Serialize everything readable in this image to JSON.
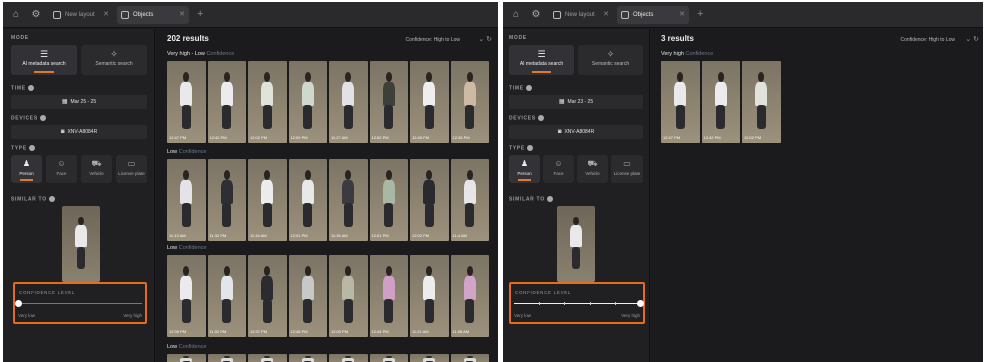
{
  "left": {
    "tabs": [
      {
        "label": "New layout",
        "active": false
      },
      {
        "label": "Objects",
        "active": true
      }
    ],
    "sidebar": {
      "mode_label": "MODE",
      "modes": [
        {
          "label": "AI metadata search",
          "icon": "layers-icon",
          "active": true
        },
        {
          "label": "Semantic search",
          "icon": "sparkle-icon",
          "active": false
        }
      ],
      "time_label": "TIME",
      "date_range": "Mar 25 - 25",
      "devices_label": "DEVICES",
      "device": "XNV-A8084R",
      "type_label": "TYPE",
      "types": [
        {
          "label": "Person",
          "icon": "person-icon",
          "active": true
        },
        {
          "label": "Face",
          "icon": "face-icon",
          "active": false
        },
        {
          "label": "Vehicle",
          "icon": "car-icon",
          "active": false
        },
        {
          "label": "License plate",
          "icon": "plate-icon",
          "active": false
        }
      ],
      "similar_label": "SIMILAR TO",
      "confidence_label": "CONFIDENCE LEVEL",
      "slider_min": "Very low",
      "slider_max": "Very high",
      "slider_value": 0.0
    },
    "main": {
      "result_count": "202 results",
      "sort_label": "Confidence: High to Low",
      "rows": [
        {
          "title": "Very high - Low",
          "subtitle": "Confidence",
          "thumbs": [
            {
              "time": "12:47 PM",
              "color": "#e9e9ec"
            },
            {
              "time": "12:42 PM",
              "color": "#ececef"
            },
            {
              "time": "12:02 PM",
              "color": "#dfe3d9"
            },
            {
              "time": "12:00 PM",
              "color": "#cfd8cc"
            },
            {
              "time": "11:27 AM",
              "color": "#e2e2e6"
            },
            {
              "time": "12:52 PM",
              "color": "#3c4038"
            },
            {
              "time": "12:45 PM",
              "color": "#eeeeee"
            },
            {
              "time": "12:35 PM",
              "color": "#cdb9a4"
            }
          ]
        },
        {
          "title": "Low",
          "subtitle": "Confidence",
          "thumbs": [
            {
              "time": "11:13 AM",
              "color": "#e4e4e8"
            },
            {
              "time": "11:32 PM",
              "color": "#2e2e33"
            },
            {
              "time": "11:34 AM",
              "color": "#ececef"
            },
            {
              "time": "12:01 PM",
              "color": "#e8e8ea"
            },
            {
              "time": "11:35 AM",
              "color": "#3b3a40"
            },
            {
              "time": "12:01 PM",
              "color": "#a9b8a2"
            },
            {
              "time": "12:02 PM",
              "color": "#2a2a2e"
            },
            {
              "time": "11:4 AM",
              "color": "#e6e6e9"
            }
          ]
        },
        {
          "title": "Low",
          "subtitle": "Confidence",
          "thumbs": [
            {
              "time": "12:39 PM",
              "color": "#ebebee"
            },
            {
              "time": "11:02 PM",
              "color": "#e2e6ea"
            },
            {
              "time": "12:37 PM",
              "color": "#2c2c30"
            },
            {
              "time": "12:48 PM",
              "color": "#c8c8ca"
            },
            {
              "time": "12:00 PM",
              "color": "#b9b8a4"
            },
            {
              "time": "12:44 PM",
              "color": "#cf9fc6"
            },
            {
              "time": "11:21 AM",
              "color": "#ececef"
            },
            {
              "time": "11:58 AM",
              "color": "#d2a4c8"
            }
          ]
        },
        {
          "title": "Low",
          "subtitle": "Confidence",
          "thumbs": []
        }
      ]
    }
  },
  "right": {
    "tabs": [
      {
        "label": "New layout",
        "active": false
      },
      {
        "label": "Objects",
        "active": true
      }
    ],
    "sidebar": {
      "mode_label": "MODE",
      "modes": [
        {
          "label": "AI metadata search",
          "icon": "layers-icon",
          "active": true
        },
        {
          "label": "Semantic search",
          "icon": "sparkle-icon",
          "active": false
        }
      ],
      "time_label": "TIME",
      "date_range": "Mar 23 - 25",
      "devices_label": "DEVICES",
      "device": "XNV-A8084R",
      "type_label": "TYPE",
      "types": [
        {
          "label": "Person",
          "icon": "person-icon",
          "active": true
        },
        {
          "label": "Face",
          "icon": "face-icon",
          "active": false
        },
        {
          "label": "Vehicle",
          "icon": "car-icon",
          "active": false
        },
        {
          "label": "License plate",
          "icon": "plate-icon",
          "active": false
        }
      ],
      "similar_label": "SIMILAR TO",
      "confidence_label": "CONFIDENCE LEVEL",
      "slider_min": "Very low",
      "slider_max": "Very high",
      "slider_value": 1.0
    },
    "main": {
      "result_count": "3 results",
      "sort_label": "Confidence: High to Low",
      "rows": [
        {
          "title": "Very high",
          "subtitle": "Confidence",
          "thumbs": [
            {
              "time": "12:47 PM",
              "color": "#e9e9ec"
            },
            {
              "time": "12:42 PM",
              "color": "#ececef"
            },
            {
              "time": "12:02 PM",
              "color": "#dfe3d9"
            }
          ]
        }
      ]
    }
  },
  "colors": {
    "accent": "#e86a1a",
    "panel": "#1b1b1d",
    "sidebar": "#202023"
  }
}
